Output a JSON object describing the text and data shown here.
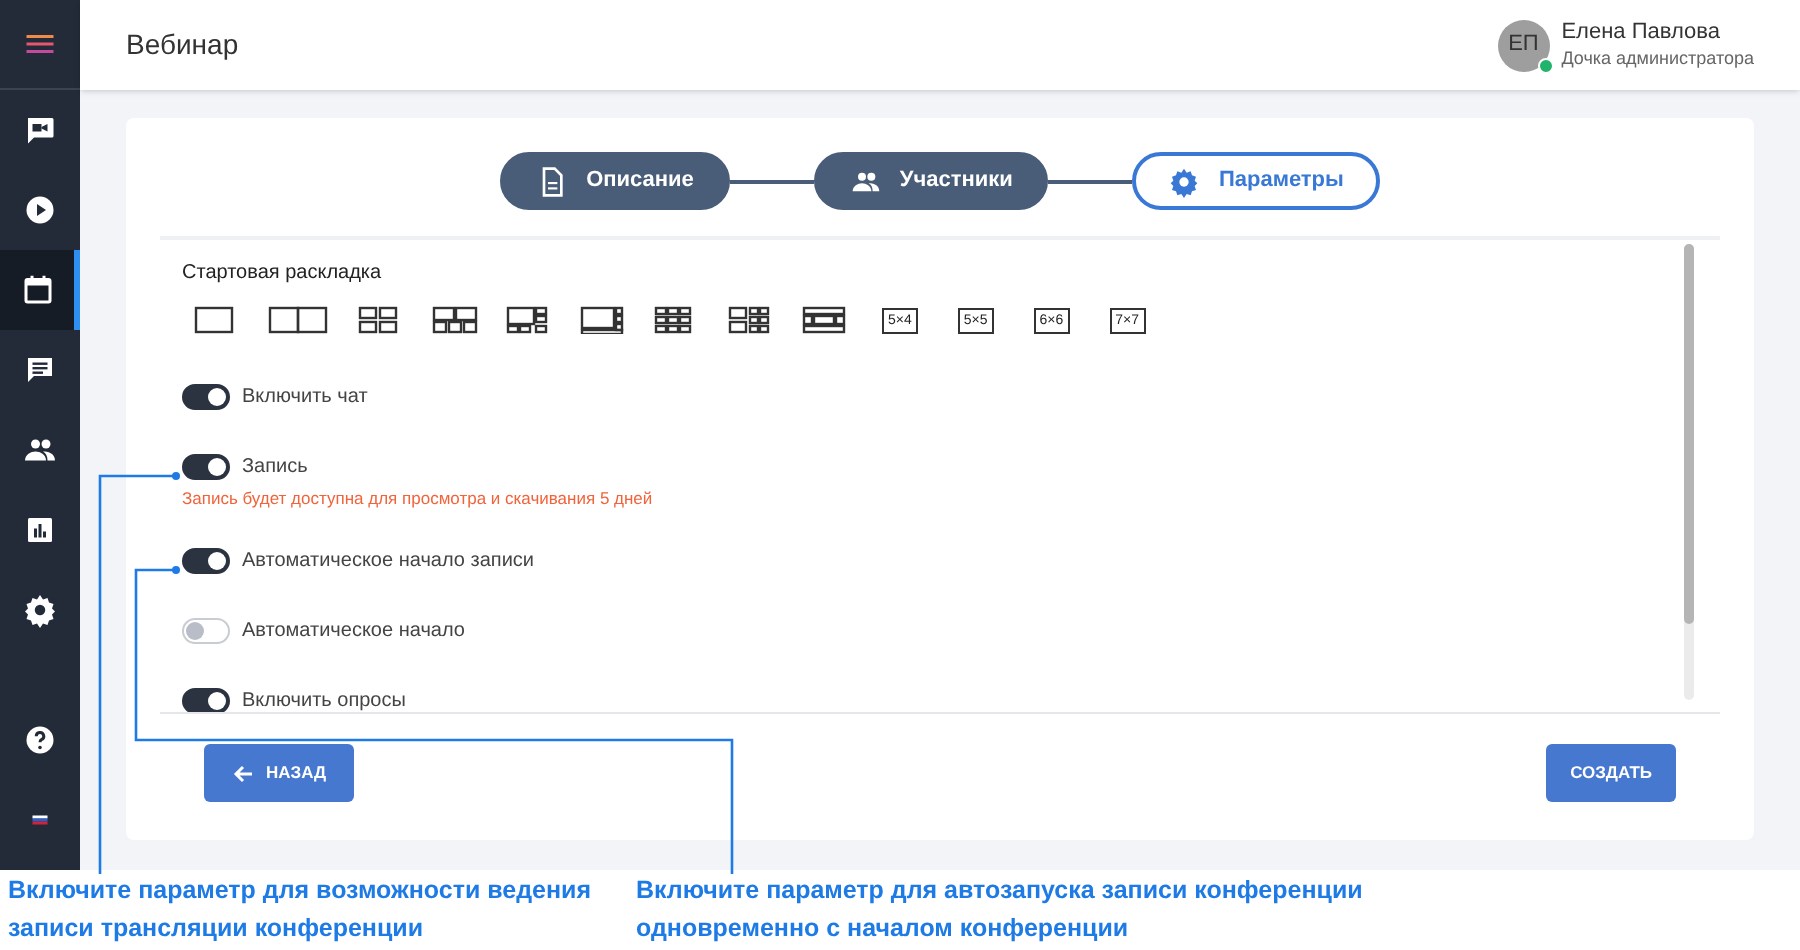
{
  "header": {
    "title": "Вебинар",
    "user": {
      "initials": "ЕП",
      "name": "Елена Павлова",
      "role": "Дочка администратора",
      "online": true
    }
  },
  "sidebar": {
    "items": [
      {
        "kind": "menu",
        "selected": false
      },
      {
        "kind": "video",
        "selected": false
      },
      {
        "kind": "play",
        "selected": false
      },
      {
        "kind": "calendar",
        "selected": true
      },
      {
        "kind": "chat",
        "selected": false
      },
      {
        "kind": "people",
        "selected": false
      },
      {
        "kind": "chart",
        "selected": false
      },
      {
        "kind": "settings",
        "selected": false
      }
    ],
    "bottom": [
      {
        "kind": "help"
      },
      {
        "kind": "flag"
      }
    ]
  },
  "steps": [
    {
      "kind": "description",
      "label": "Описание",
      "selected": false
    },
    {
      "kind": "participants",
      "label": "Участники",
      "selected": false
    },
    {
      "kind": "settings",
      "label": "Параметры",
      "selected": true
    }
  ],
  "layouts": {
    "title": "Стартовая раскладка",
    "items": [
      {
        "kind": "icon"
      },
      {
        "kind": "icon"
      },
      {
        "kind": "icon"
      },
      {
        "kind": "icon"
      },
      {
        "kind": "icon"
      },
      {
        "kind": "icon"
      },
      {
        "kind": "icon"
      },
      {
        "kind": "icon"
      },
      {
        "kind": "icon"
      },
      {
        "kind": "label",
        "label": "5×4"
      },
      {
        "kind": "label",
        "label": "5×5"
      },
      {
        "kind": "label",
        "label": "6×6"
      },
      {
        "kind": "label",
        "label": "7×7"
      }
    ]
  },
  "options": [
    {
      "label": "Включить чат",
      "on": true
    },
    {
      "label": "Запись",
      "on": true,
      "note": "Запись будет доступна для просмотра и скачивания 5 дней"
    },
    {
      "label": "Автоматическое начало записи",
      "on": true
    },
    {
      "label": "Автоматическое начало",
      "on": false
    },
    {
      "label": "Включить опросы",
      "on": true
    }
  ],
  "buttons": [
    {
      "kind": "back",
      "label": "НАЗАД"
    },
    {
      "kind": "create",
      "label": "СОЗДАТЬ"
    }
  ],
  "annotations": [
    "Включите параметр для возможности ведения записи трансляции конференции",
    "Включите параметр для автозапуска записи конференции одновременно с началом конференции"
  ]
}
